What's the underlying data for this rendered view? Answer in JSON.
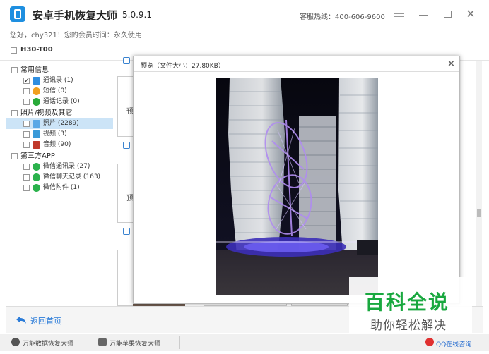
{
  "app": {
    "title": "安卓手机恢复大师",
    "version": "5.0.9.1",
    "hotline": "客服热线：400-606-9600",
    "greeting": "您好，chy321！您的会员时间：永久使用",
    "brand_color": "#1e8fe0"
  },
  "device": {
    "name": "H30-T00"
  },
  "sidebar": {
    "categories": [
      {
        "label": "常用信息",
        "items": [
          {
            "label": "通讯录 (1)",
            "icon": "contacts-icon",
            "checked": true
          },
          {
            "label": "短信 (0)",
            "icon": "sms-icon",
            "checked": false
          },
          {
            "label": "通话记录 (0)",
            "icon": "call-log-icon",
            "checked": false
          }
        ]
      },
      {
        "label": "照片/视频及其它",
        "items": [
          {
            "label": "照片 (2289)",
            "icon": "photo-icon",
            "checked": false,
            "selected": true
          },
          {
            "label": "视频 (3)",
            "icon": "video-icon",
            "checked": false
          },
          {
            "label": "音频 (90)",
            "icon": "audio-icon",
            "checked": false
          }
        ]
      },
      {
        "label": "第三方APP",
        "items": [
          {
            "label": "微信通讯录 (27)",
            "icon": "wechat-icon",
            "checked": false
          },
          {
            "label": "微信聊天记录 (163)",
            "icon": "wechat-icon",
            "checked": false
          },
          {
            "label": "微信附件 (1)",
            "icon": "wechat-icon",
            "checked": false
          }
        ]
      }
    ]
  },
  "background_cards": {
    "preview_label": "预"
  },
  "preview": {
    "title": "预览（文件大小：27.80KB）",
    "close": "×"
  },
  "footer": {
    "back_label": "返回首页"
  },
  "statusbar": {
    "item1": "万能数据恢复大师",
    "item2": "万能苹果恢复大师",
    "qq": "QQ在线咨询"
  },
  "watermark": {
    "title": "百科全说",
    "subtitle": "助你轻松解决"
  }
}
